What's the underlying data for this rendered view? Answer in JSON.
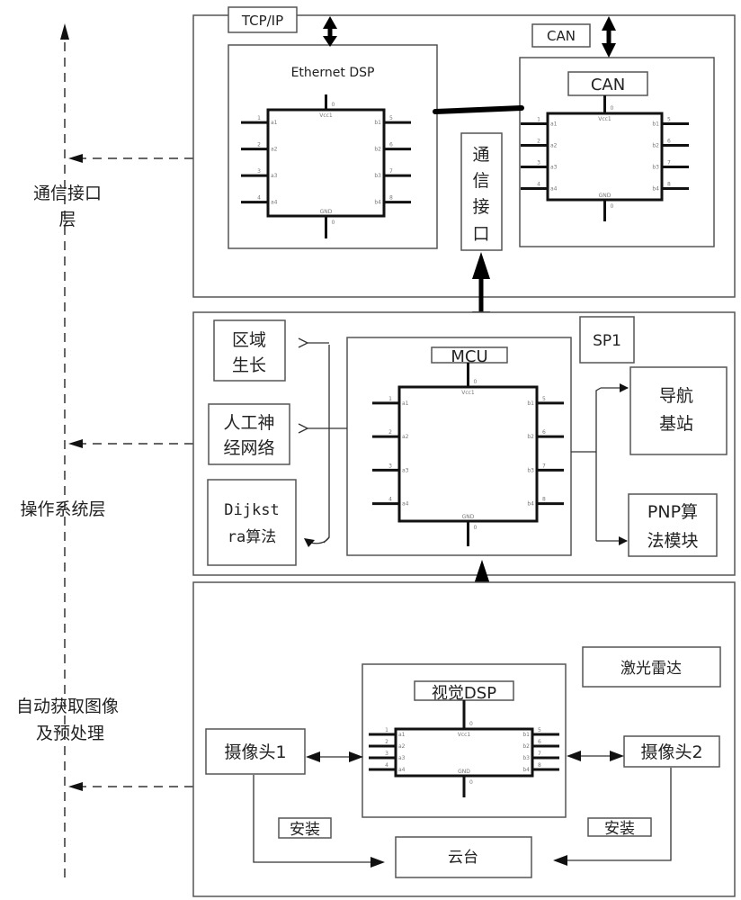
{
  "diagram": {
    "layers": [
      {
        "id": "comm",
        "label_lines": [
          "通信接口",
          "层"
        ]
      },
      {
        "id": "os",
        "label_lines": [
          "操作系统层"
        ]
      },
      {
        "id": "acq",
        "label_lines": [
          "自动获取图像",
          "及预处理"
        ]
      }
    ],
    "comm_section": {
      "tcp_label": "TCP/IP",
      "can_outer_label": "CAN",
      "ethernet_chip_title": "Ethernet DSP",
      "can_chip_title": "CAN",
      "interface_box_chars": [
        "通",
        "信",
        "接",
        "口"
      ]
    },
    "os_section": {
      "mcu_title": "MCU",
      "sp1_label": "SP1",
      "region_growing_lines": [
        "区域",
        "生长"
      ],
      "ann_lines": [
        "人工神",
        "经网络"
      ],
      "dijkstra_lines": [
        "Dijkst",
        "ra算法"
      ],
      "nav_station_lines": [
        "导航",
        "基站"
      ],
      "pnp_lines": [
        "PNP算",
        "法模块"
      ]
    },
    "acq_section": {
      "vision_dsp_title": "视觉DSP",
      "lidar_label": "激光雷达",
      "camera1_label": "摄像头1",
      "camera2_label": "摄像头2",
      "mount_label_left": "安装",
      "mount_label_right": "安装",
      "gimbal_label": "云台"
    },
    "chip_pins": {
      "vcc": "Vcc1",
      "gnd": "GND",
      "power_pin": "0",
      "left_names": [
        "a1",
        "a2",
        "a3",
        "a4"
      ],
      "right_names": [
        "b1",
        "b2",
        "b3",
        "b4"
      ],
      "left_numbers": [
        "1",
        "2",
        "3",
        "4"
      ],
      "right_numbers": [
        "5",
        "6",
        "7",
        "8"
      ]
    }
  }
}
